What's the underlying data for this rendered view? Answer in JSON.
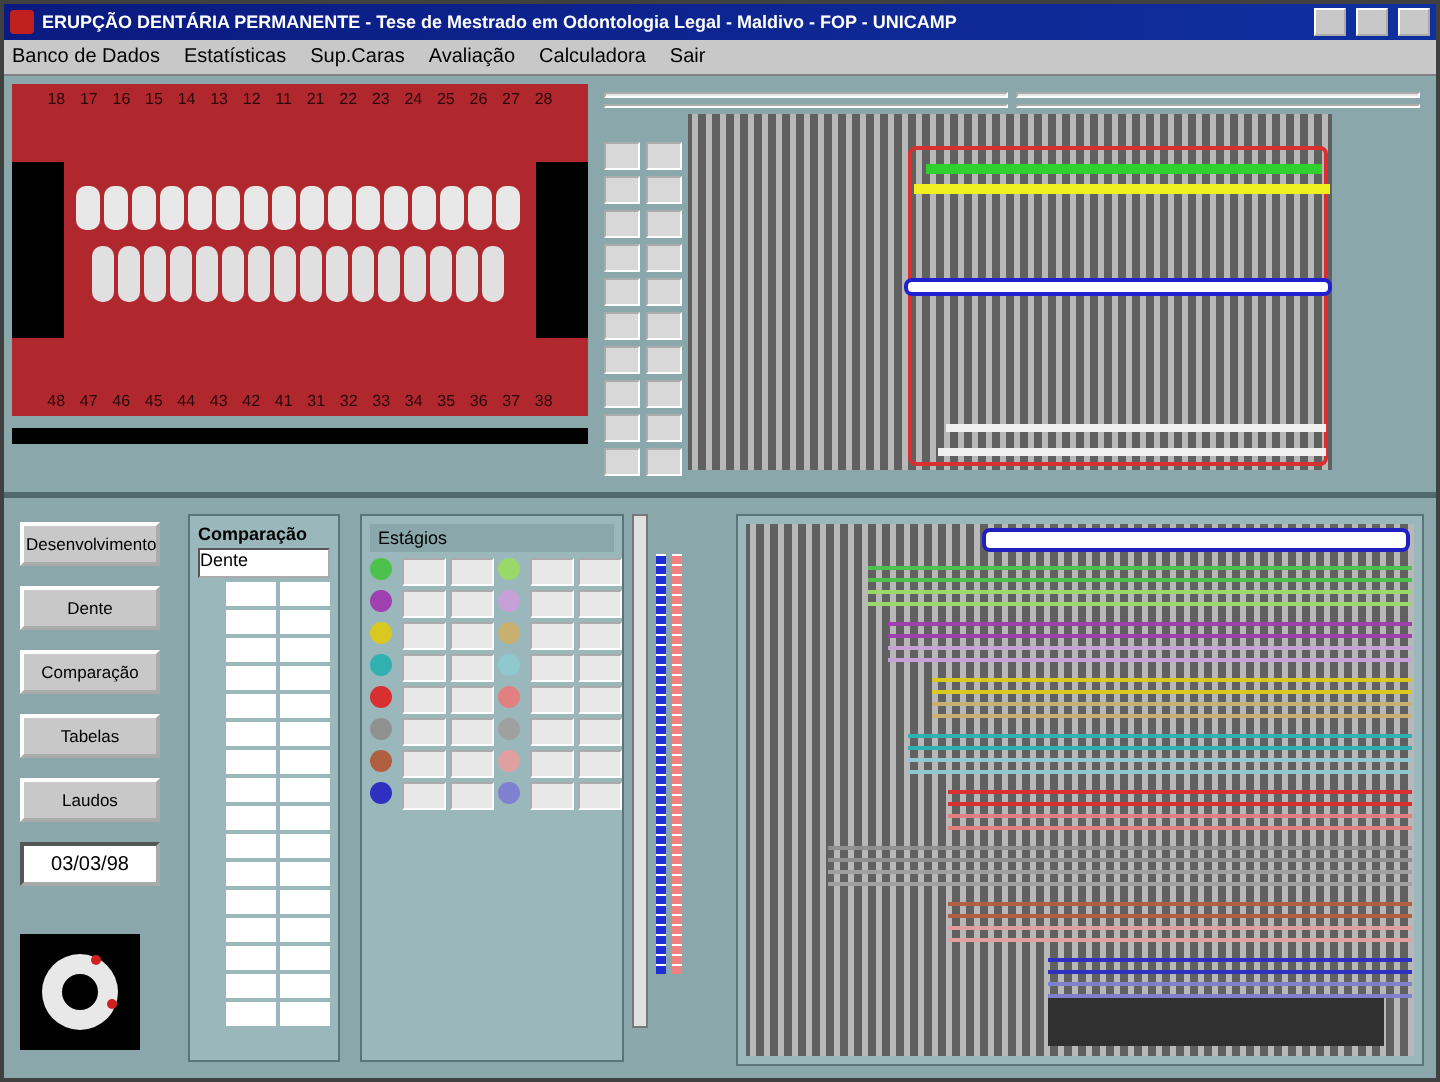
{
  "window": {
    "title": "ERUPÇÃO DENTÁRIA PERMANENTE - Tese de Mestrado em Odontologia Legal - Maldivo - FOP - UNICAMP"
  },
  "menu": [
    {
      "label": "Banco de Dados"
    },
    {
      "label": "Estatísticas"
    },
    {
      "label": "Sup.Caras"
    },
    {
      "label": "Avaliação"
    },
    {
      "label": "Calculadora"
    },
    {
      "label": "Sair"
    }
  ],
  "radiograph": {
    "upper_teeth": [
      "18",
      "17",
      "16",
      "15",
      "14",
      "13",
      "12",
      "11",
      "21",
      "22",
      "23",
      "24",
      "25",
      "26",
      "27",
      "28"
    ],
    "lower_teeth": [
      "48",
      "47",
      "46",
      "45",
      "44",
      "43",
      "42",
      "41",
      "31",
      "32",
      "33",
      "34",
      "35",
      "36",
      "37",
      "38"
    ]
  },
  "side_buttons": [
    {
      "label": "Desenvolvimento"
    },
    {
      "label": "Dente"
    },
    {
      "label": "Comparação"
    },
    {
      "label": "Tabelas"
    },
    {
      "label": "Laudos"
    }
  ],
  "date": "03/03/98",
  "comparison": {
    "title": "Comparação",
    "dropdown": "Dente"
  },
  "stages": {
    "title": "Estágios",
    "legend": [
      {
        "color": "#4cc24c"
      },
      {
        "color": "#9ad86a"
      },
      {
        "color": "#a040b0"
      },
      {
        "color": "#c8a0d8"
      },
      {
        "color": "#d8c820"
      },
      {
        "color": "#c8b070"
      },
      {
        "color": "#30b0b0"
      },
      {
        "color": "#90c8d0"
      },
      {
        "color": "#d83030"
      },
      {
        "color": "#e08080"
      },
      {
        "color": "#909090"
      },
      {
        "color": "#a0a0a0"
      },
      {
        "color": "#b06040"
      },
      {
        "color": "#e0a0a0"
      },
      {
        "color": "#3030c0"
      },
      {
        "color": "#8080d0"
      }
    ]
  }
}
